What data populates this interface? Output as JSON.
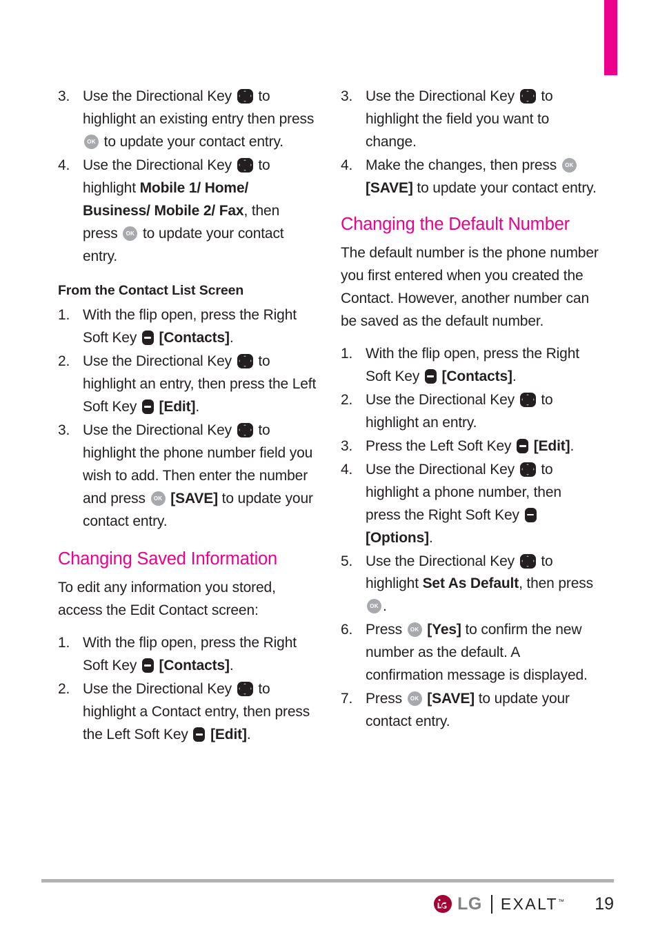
{
  "page": {
    "number": "19",
    "accent_color": "#ec008c",
    "text_color": "#231f20"
  },
  "footer": {
    "brand": "LG",
    "product": "EXALT",
    "trademark": "™",
    "page_number": "19"
  },
  "left_column": {
    "step3": {
      "num": "3.",
      "t1": "Use the Directional Key ",
      "t2": " to highlight an existing entry then press ",
      "t3": " to update your contact entry."
    },
    "step4": {
      "num": "4.",
      "t1": "Use the Directional Key ",
      "t2": " to highlight ",
      "bold": "Mobile 1/ Home/ Business/ Mobile 2/ Fax",
      "t3": ", then press ",
      "t4": " to update your contact entry."
    },
    "heading_contact_list": "From the Contact List Screen",
    "cl_step1": {
      "num": "1.",
      "t1": "With the flip open, press the Right Soft Key ",
      "bold": " [Contacts]",
      "t2": "."
    },
    "cl_step2": {
      "num": "2.",
      "t1": "Use the Directional Key ",
      "t2": " to highlight an entry, then press the Left Soft Key ",
      "bold": " [Edit]",
      "t3": "."
    },
    "cl_step3": {
      "num": "3.",
      "t1": "Use the Directional Key ",
      "t2": " to highlight the phone number field you wish to add. Then enter the number and press ",
      "bold": " [SAVE]",
      "t3": " to update your contact entry."
    },
    "heading_changing_saved": "Changing Saved Information",
    "intro": "To edit any information you stored, access the Edit Contact screen:",
    "cs_step1": {
      "num": "1.",
      "t1": "With the flip open, press the Right Soft Key ",
      "bold": " [Contacts]",
      "t2": "."
    },
    "cs_step2": {
      "num": "2.",
      "t1": "Use the Directional Key ",
      "t2": " to highlight a Contact entry, then press the Left Soft Key ",
      "bold": " [Edit]",
      "t3": "."
    }
  },
  "right_column": {
    "step3": {
      "num": "3.",
      "t1": "Use the Directional Key ",
      "t2": " to highlight the field you want to change."
    },
    "step4": {
      "num": "4.",
      "t1": "Make the changes, then press ",
      "bold": " [SAVE]",
      "t2": " to update your contact entry."
    },
    "heading_default_number": "Changing the Default Number",
    "intro": "The default number is the phone number you first entered when you created the Contact. However, another number can be saved as the default number.",
    "dn_step1": {
      "num": "1.",
      "t1": "With the flip open, press the Right Soft Key ",
      "bold": " [Contacts]",
      "t2": "."
    },
    "dn_step2": {
      "num": "2.",
      "t1": "Use the Directional Key ",
      "t2": " to highlight an entry."
    },
    "dn_step3": {
      "num": "3.",
      "t1": "Press the Left Soft Key ",
      "bold": " [Edit]",
      "t2": "."
    },
    "dn_step4": {
      "num": "4.",
      "t1": "Use the Directional Key ",
      "t2": " to highlight a phone number, then press the Right Soft Key ",
      "bold": " [Options]",
      "t3": "."
    },
    "dn_step5": {
      "num": "5.",
      "t1": "Use the Directional Key ",
      "t2": " to highlight ",
      "bold": "Set As Default",
      "t3": ", then press ",
      "t4": "."
    },
    "dn_step6": {
      "num": "6.",
      "t1": "Press ",
      "bold": " [Yes]",
      "t2": " to confirm the new number as the default. A confirmation message is displayed."
    },
    "dn_step7": {
      "num": "7.",
      "t1": "Press ",
      "bold": " [SAVE]",
      "t2": " to update your contact entry."
    }
  },
  "icons": {
    "directional_key": "directional-key-icon",
    "soft_key": "soft-key-icon",
    "ok_key": "ok-key-icon",
    "ok_label": "OK"
  }
}
